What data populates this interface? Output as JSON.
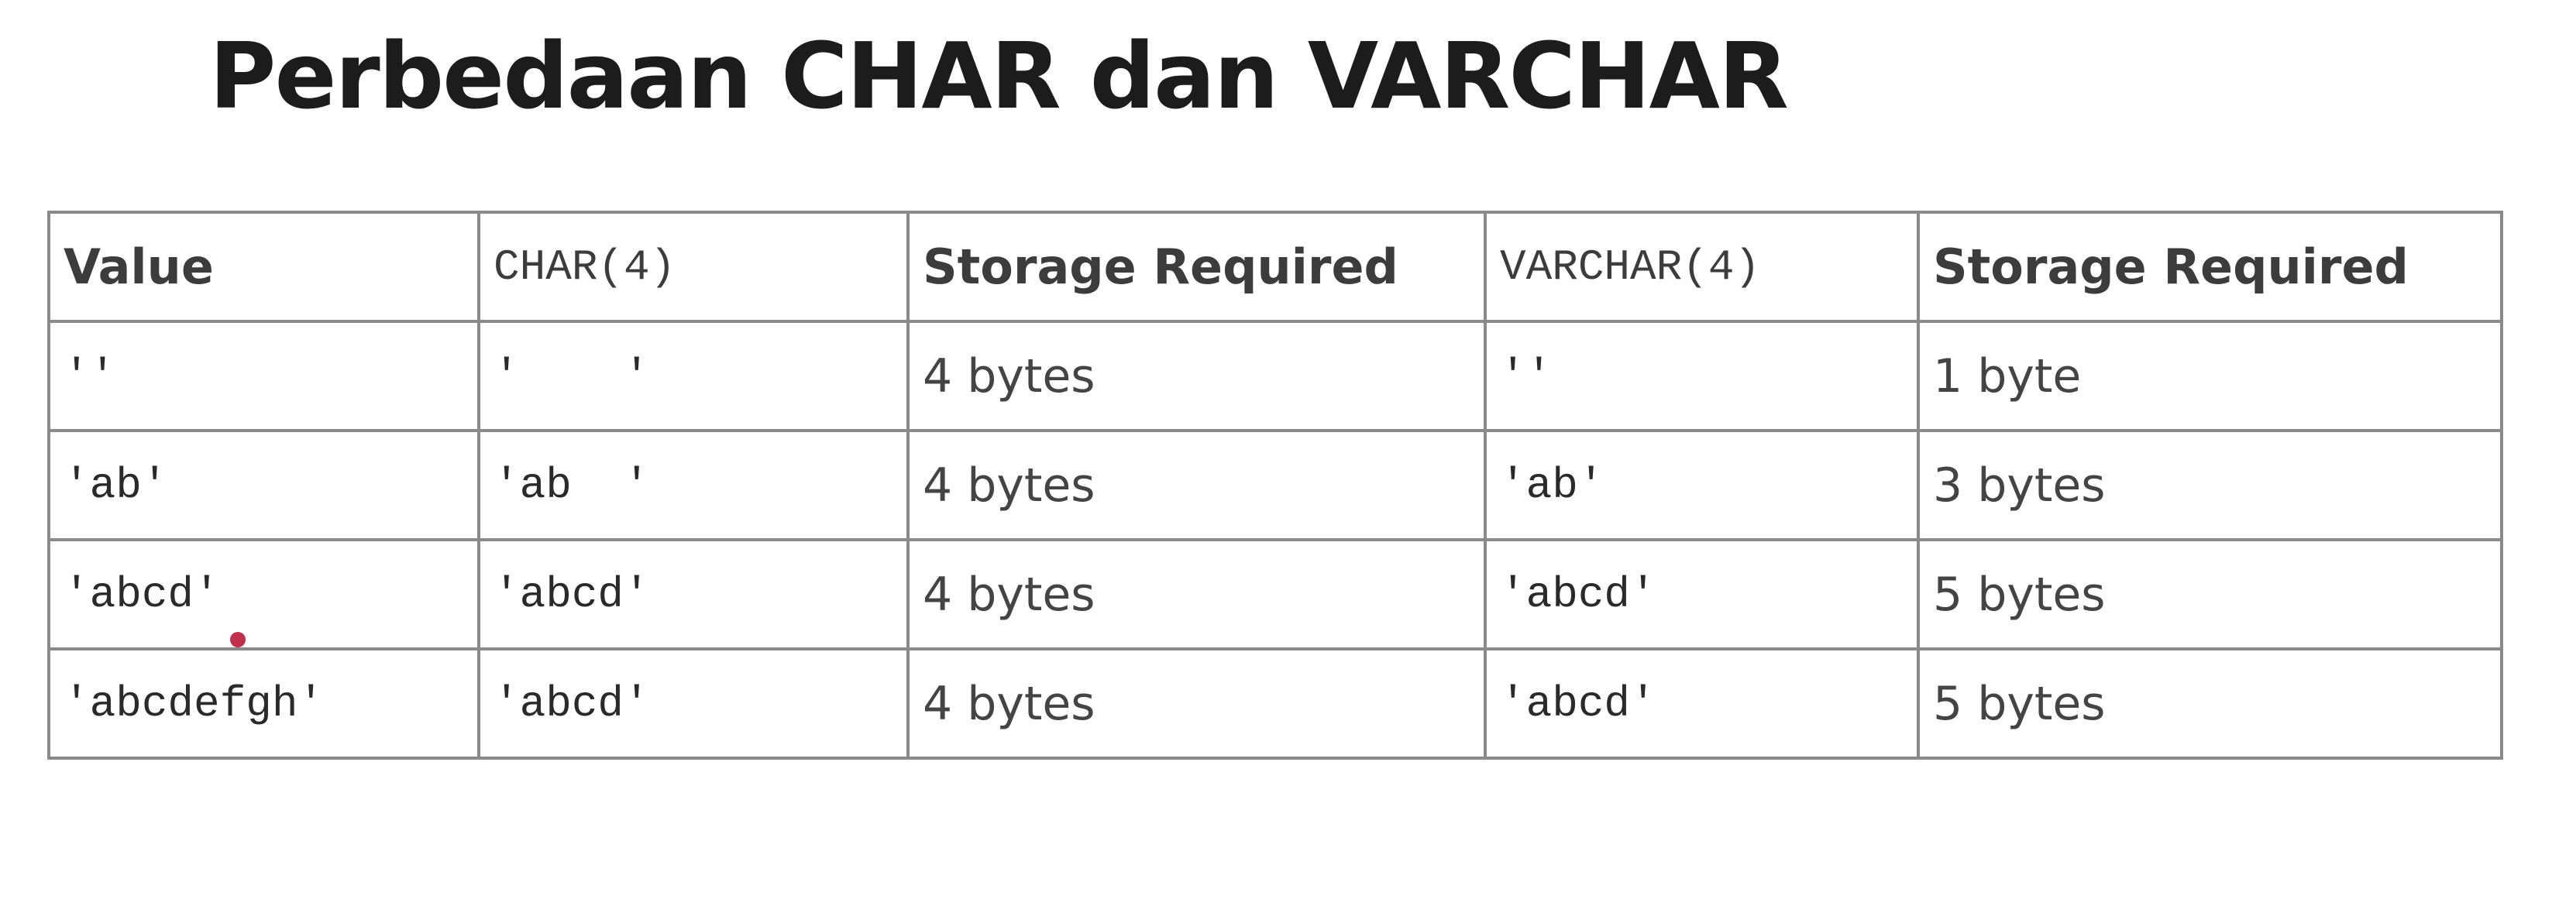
{
  "title": "Perbedaan CHAR dan VARCHAR",
  "table": {
    "headers": [
      "Value",
      "CHAR(4)",
      "Storage Required",
      "VARCHAR(4)",
      "Storage Required"
    ],
    "rows": [
      [
        "''",
        "'    '",
        "4 bytes",
        "''",
        "1 byte"
      ],
      [
        "'ab'",
        "'ab  '",
        "4 bytes",
        "'ab'",
        "3 bytes"
      ],
      [
        "'abcd'",
        "'abcd'",
        "4 bytes",
        "'abcd'",
        "5 bytes"
      ],
      [
        "'abcdefgh'",
        "'abcd'",
        "4 bytes",
        "'abcd'",
        "5 bytes"
      ]
    ]
  },
  "colors": {
    "border": "#8a8a8a",
    "title": "#1c1c1c",
    "cursor": "#c0304a"
  }
}
